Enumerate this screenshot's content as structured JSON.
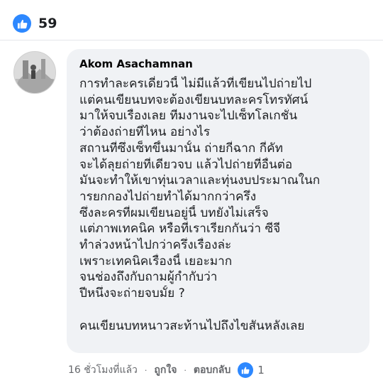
{
  "reactions": {
    "like_count": "59",
    "icon": "thumbs-up-icon",
    "color": "#2d88ff"
  },
  "comment": {
    "author": "Akom Asachamnan",
    "avatar_icon": "avatar-photo",
    "lines": [
      "การทำละครเดี๋ยวนี้ ไม่มีแล้วที่เขียนไปถ่ายไป",
      "แต่คนเขียนบทจะต้องเขียนบทละครโทรทัศน์",
      "มาให้จบเรื่องเลย ทีมงานจะไปเซ็ทโลเกชั่น",
      "ว่าต้องถ่ายที่ไหน อย่างไร",
      "สถานที่ซึ่งเซ็ทขึ้นมานั้น ถ่ายกี่ฉาก กี่คัท",
      "จะได้ลุยถ่ายที่เดียวจบ แล้วไปถ่ายที่อื่นต่อ",
      "มันจะทำให้เขาทุ่นเวลาและทุ่นงบประมาณในก",
      "ารยกกองไปถ่ายทำได้มากกว่าครึ่ง",
      "ซึ่งละครที่ผมเขียนอยู่นี้ บทยังไม่เสร็จ",
      "แต่ภาพเทคนิค หรือที่เราเรียกกันว่า ซีจี",
      "ทำล่วงหน้าไปกว่าครึ่งเรื่องล่ะ",
      "เพราะเทคนิคเรื่องนี้ เยอะมาก",
      "จนช่องถึงกับถามผู้กำกับว่า",
      "ปีหนึ่งจะถ่ายจบมั้ย ?",
      "",
      "คนเขียนบทหนาวสะท้านไปถึงไขสันหลังเลย"
    ]
  },
  "footer": {
    "time": "16 ชั่วโมงที่แล้ว",
    "like_label": "ถูกใจ",
    "reply_label": "ตอบกลับ",
    "reaction_count": "1",
    "separator": "·"
  }
}
